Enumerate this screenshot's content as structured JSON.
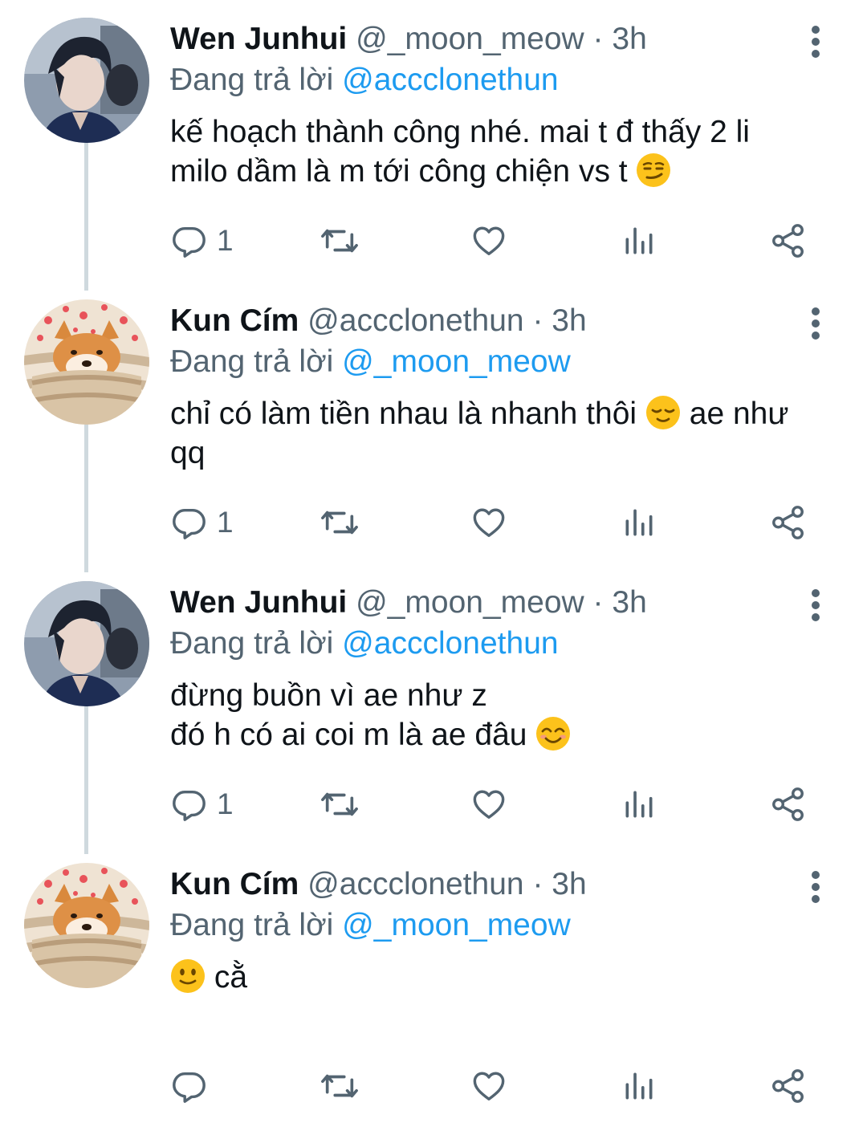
{
  "tweets": [
    {
      "avatar": "person-avatar",
      "name": "Wen Junhui",
      "handle": "@_moon_meow",
      "separator": "·",
      "time": "3h",
      "replying_prefix": "Đang trả lời",
      "replying_to": "@accclonethun",
      "body": {
        "line1": "kế hoạch thành công nhé. mai t đ thấy 2 li",
        "line2": "milo dầm là m tới công chiện vs t",
        "line2_emoji": "smirk-emoji",
        "line3": ""
      },
      "reply_count": "1"
    },
    {
      "avatar": "shiba-dog-avatar",
      "name": "Kun Cím",
      "handle": "@accclonethun",
      "separator": "·",
      "time": "3h",
      "replying_prefix": "Đang trả lời",
      "replying_to": "@_moon_meow",
      "body": {
        "line1": "chỉ có làm tiền nhau là nhanh thôi",
        "line1_emoji": "relieved-emoji",
        "line1_after": "ae như",
        "line2": "qq"
      },
      "reply_count": "1"
    },
    {
      "avatar": "person-avatar",
      "name": "Wen Junhui",
      "handle": "@_moon_meow",
      "separator": "·",
      "time": "3h",
      "replying_prefix": "Đang trả lời",
      "replying_to": "@accclonethun",
      "body": {
        "line1": "đừng buồn vì ae như z",
        "line2": "đó h có ai coi m là ae đâu",
        "line2_emoji": "smiling-emoji"
      },
      "reply_count": "1"
    },
    {
      "avatar": "shiba-dog-avatar",
      "name": "Kun Cím",
      "handle": "@accclonethun",
      "separator": "·",
      "time": "3h",
      "replying_prefix": "Đang trả lời",
      "replying_to": "@_moon_meow",
      "body": {
        "line1_emoji": "slight-smile-emoji",
        "line1": "cằ"
      },
      "reply_count": ""
    }
  ],
  "colors": {
    "text_primary": "#0f1419",
    "text_secondary": "#536471",
    "link": "#1d9bf0",
    "thread_line": "#cfd9de"
  },
  "icons": [
    "reply-icon",
    "retweet-icon",
    "like-icon",
    "analytics-icon",
    "share-icon",
    "more-options-icon"
  ]
}
